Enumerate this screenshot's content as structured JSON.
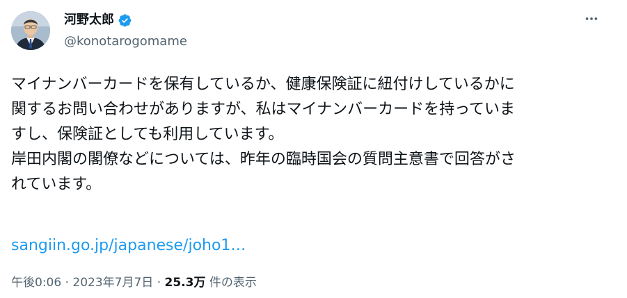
{
  "author": {
    "display_name": "河野太郎",
    "handle": "@konotarogomame",
    "verified": true,
    "avatar_icon": "person-in-suit-avatar"
  },
  "more_icon": "more-horizontal-icon",
  "tweet": {
    "lines": [
      "マイナンバーカードを保有しているか、健康保険証に紐付けしているかに",
      "関するお問い合わせがありますが、私はマイナンバーカードを持っていま",
      "すし、保険証としても利用しています。",
      "岸田内閣の閣僚などについては、昨年の臨時国会の質問主意書で回答がさ",
      "れています。"
    ],
    "link_text": "sangiin.go.jp/japanese/joho1…"
  },
  "meta": {
    "time": "午後0:06",
    "separator": " · ",
    "date": "2023年7月7日",
    "views_count": "25.3万",
    "views_label": " 件の表示"
  },
  "colors": {
    "text": "#0f1419",
    "secondary": "#536471",
    "link": "#1d9bf0",
    "verified_badge": "#1d9bf0"
  }
}
